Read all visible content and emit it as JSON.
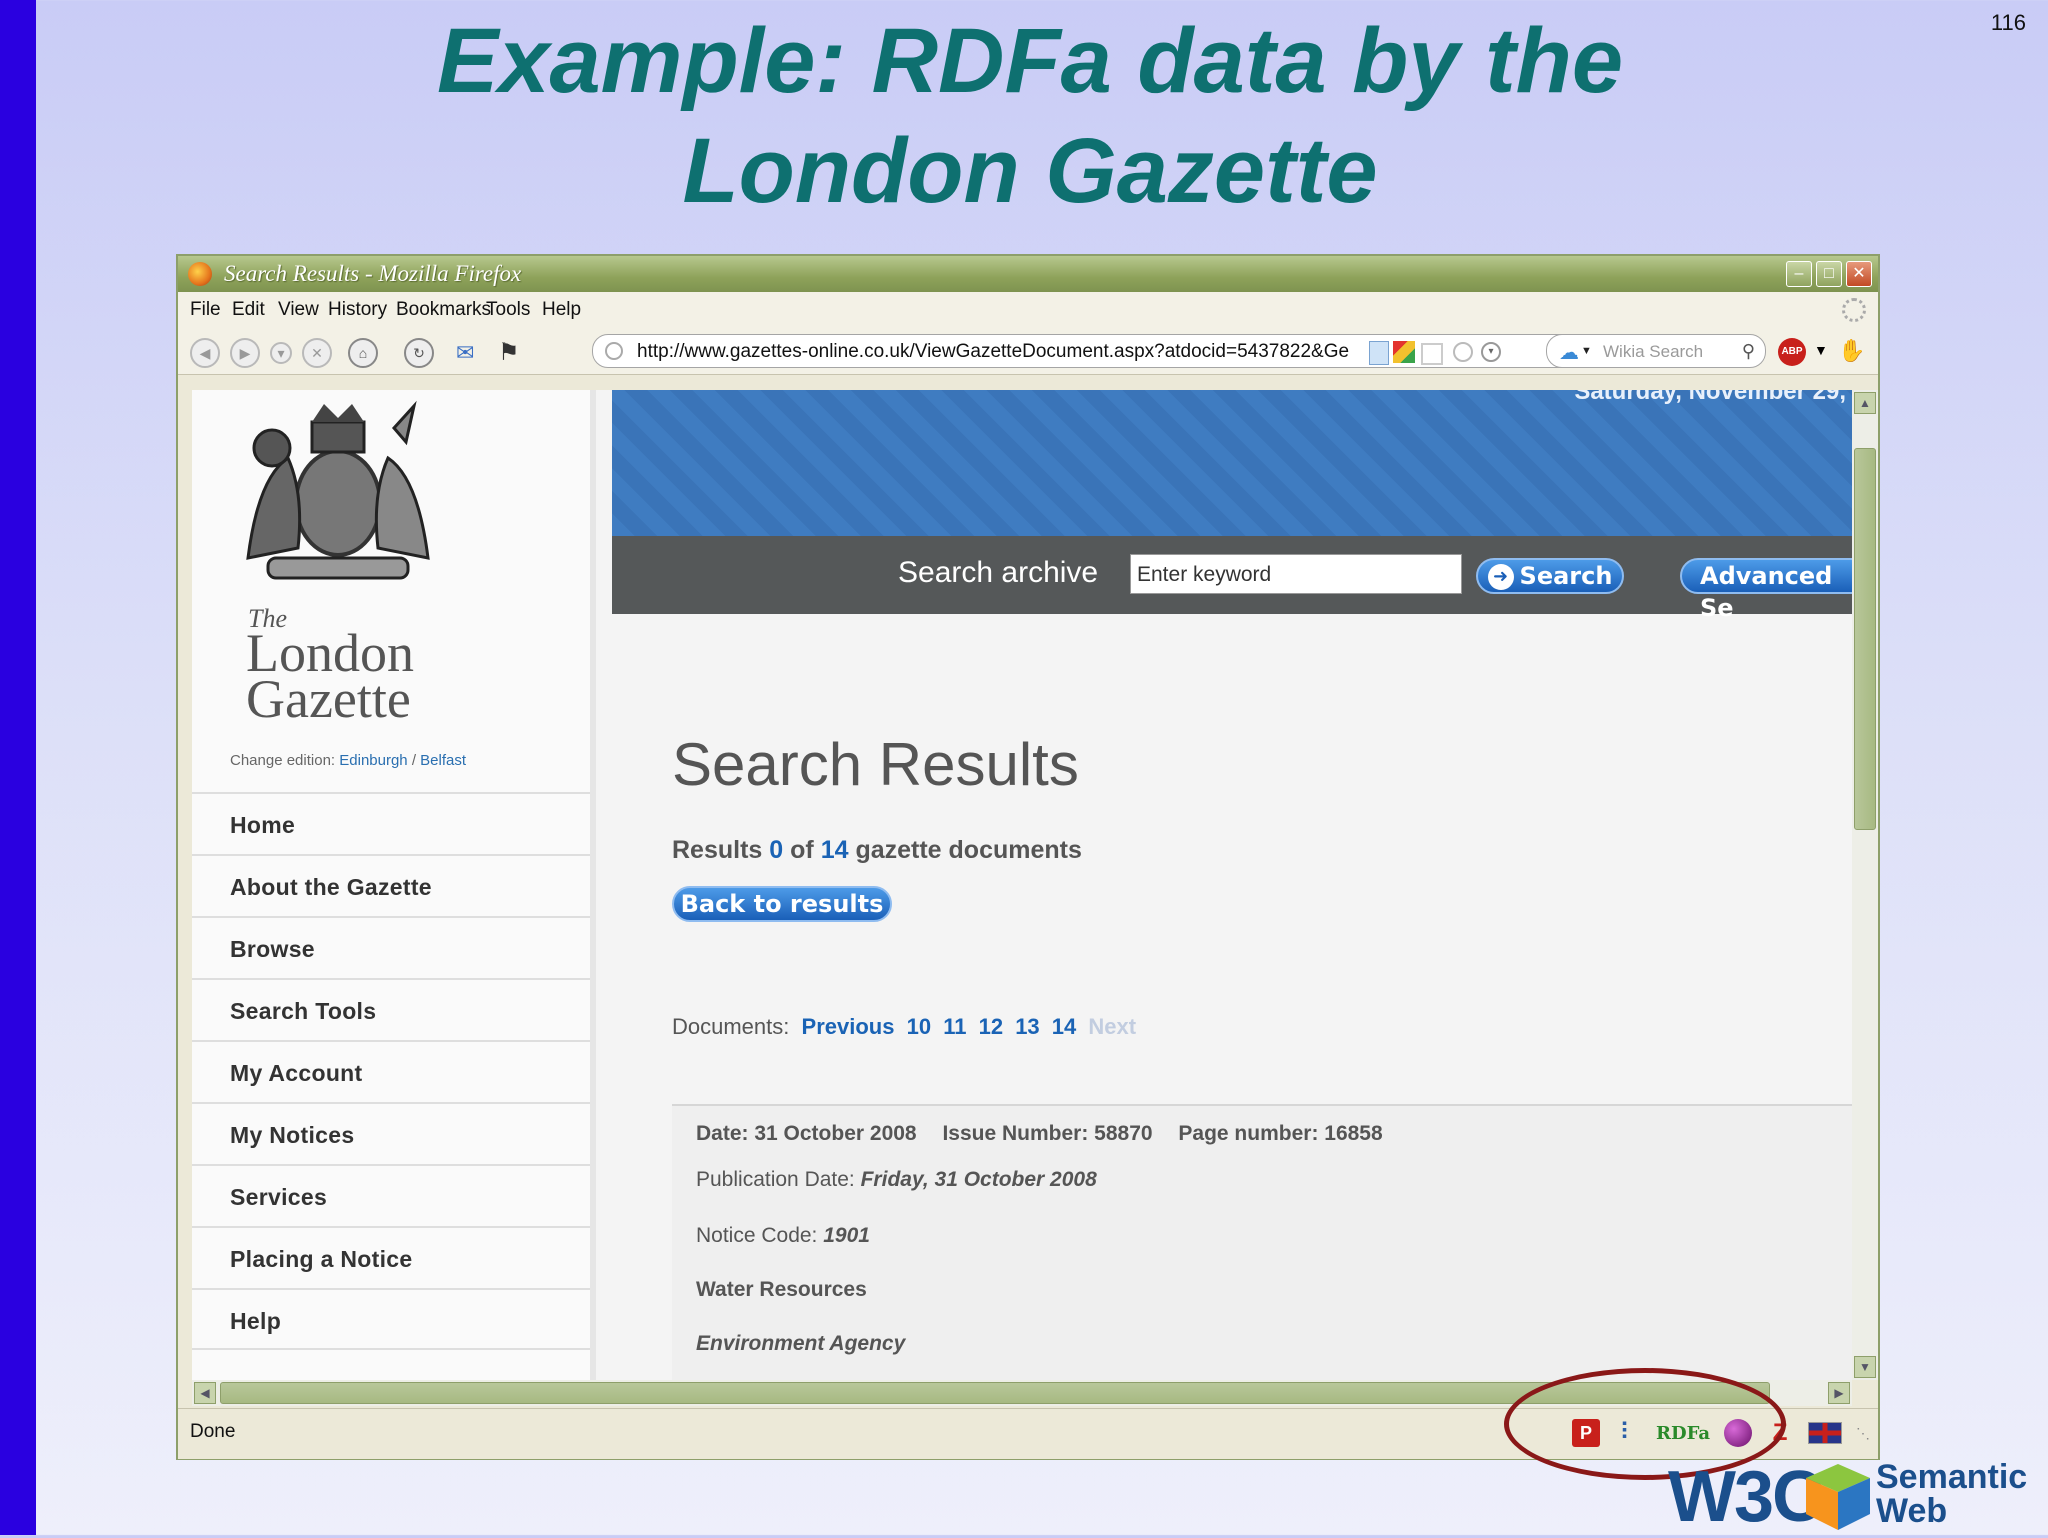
{
  "slide": {
    "number": "116",
    "title_line1": "Example: RDFa data by the",
    "title_line2": "London Gazette"
  },
  "window": {
    "title": "Search Results - Mozilla Firefox",
    "menu": [
      "File",
      "Edit",
      "View",
      "History",
      "Bookmarks",
      "Tools",
      "Help"
    ],
    "url": "http://www.gazettes-online.co.uk/ViewGazetteDocument.aspx?atdocid=5437822&Ge",
    "search_placeholder": "Wikia Search",
    "status": "Done",
    "status_rdfa": "RDFa"
  },
  "sidebar": {
    "logo_the": "The",
    "logo_london": "London",
    "logo_gazette": "Gazette",
    "edition_label": "Change edition:",
    "edition_edinburgh": "Edinburgh",
    "edition_sep": "/",
    "edition_belfast": "Belfast",
    "nav": [
      "Home",
      "About the Gazette",
      "Browse",
      "Search Tools",
      "My Account",
      "My Notices",
      "Services",
      "Placing a Notice",
      "Help"
    ]
  },
  "banner": {
    "date": "Saturday, November 29,"
  },
  "search": {
    "label": "Search archive",
    "keyword": "Enter keyword",
    "button": "Search",
    "advanced": "Advanced Se"
  },
  "results": {
    "heading": "Search Results",
    "prefix": "Results",
    "current": "0",
    "of": "of",
    "total": "14",
    "suffix": "gazette documents",
    "back": "Back to results",
    "docs_label": "Documents:",
    "previous": "Previous",
    "pages": [
      "10",
      "11",
      "12",
      "13",
      "14"
    ],
    "next": "Next"
  },
  "detail": {
    "date": "Date: 31 October 2008",
    "issue": "Issue Number: 58870",
    "page": "Page number: 16858",
    "pub_label": "Publication Date:",
    "pub_value": "Friday, 31 October 2008",
    "code_label": "Notice Code:",
    "code_value": "1901",
    "category": "Water Resources",
    "org": "Environment Agency"
  },
  "footer": {
    "w3c": "W3C",
    "semantic": "Semantic",
    "web": "Web"
  },
  "colors": {
    "title": "#0e7070",
    "accent_bar": "#2a00e0",
    "link": "#1a63b5",
    "ellipse": "#8a1818"
  }
}
